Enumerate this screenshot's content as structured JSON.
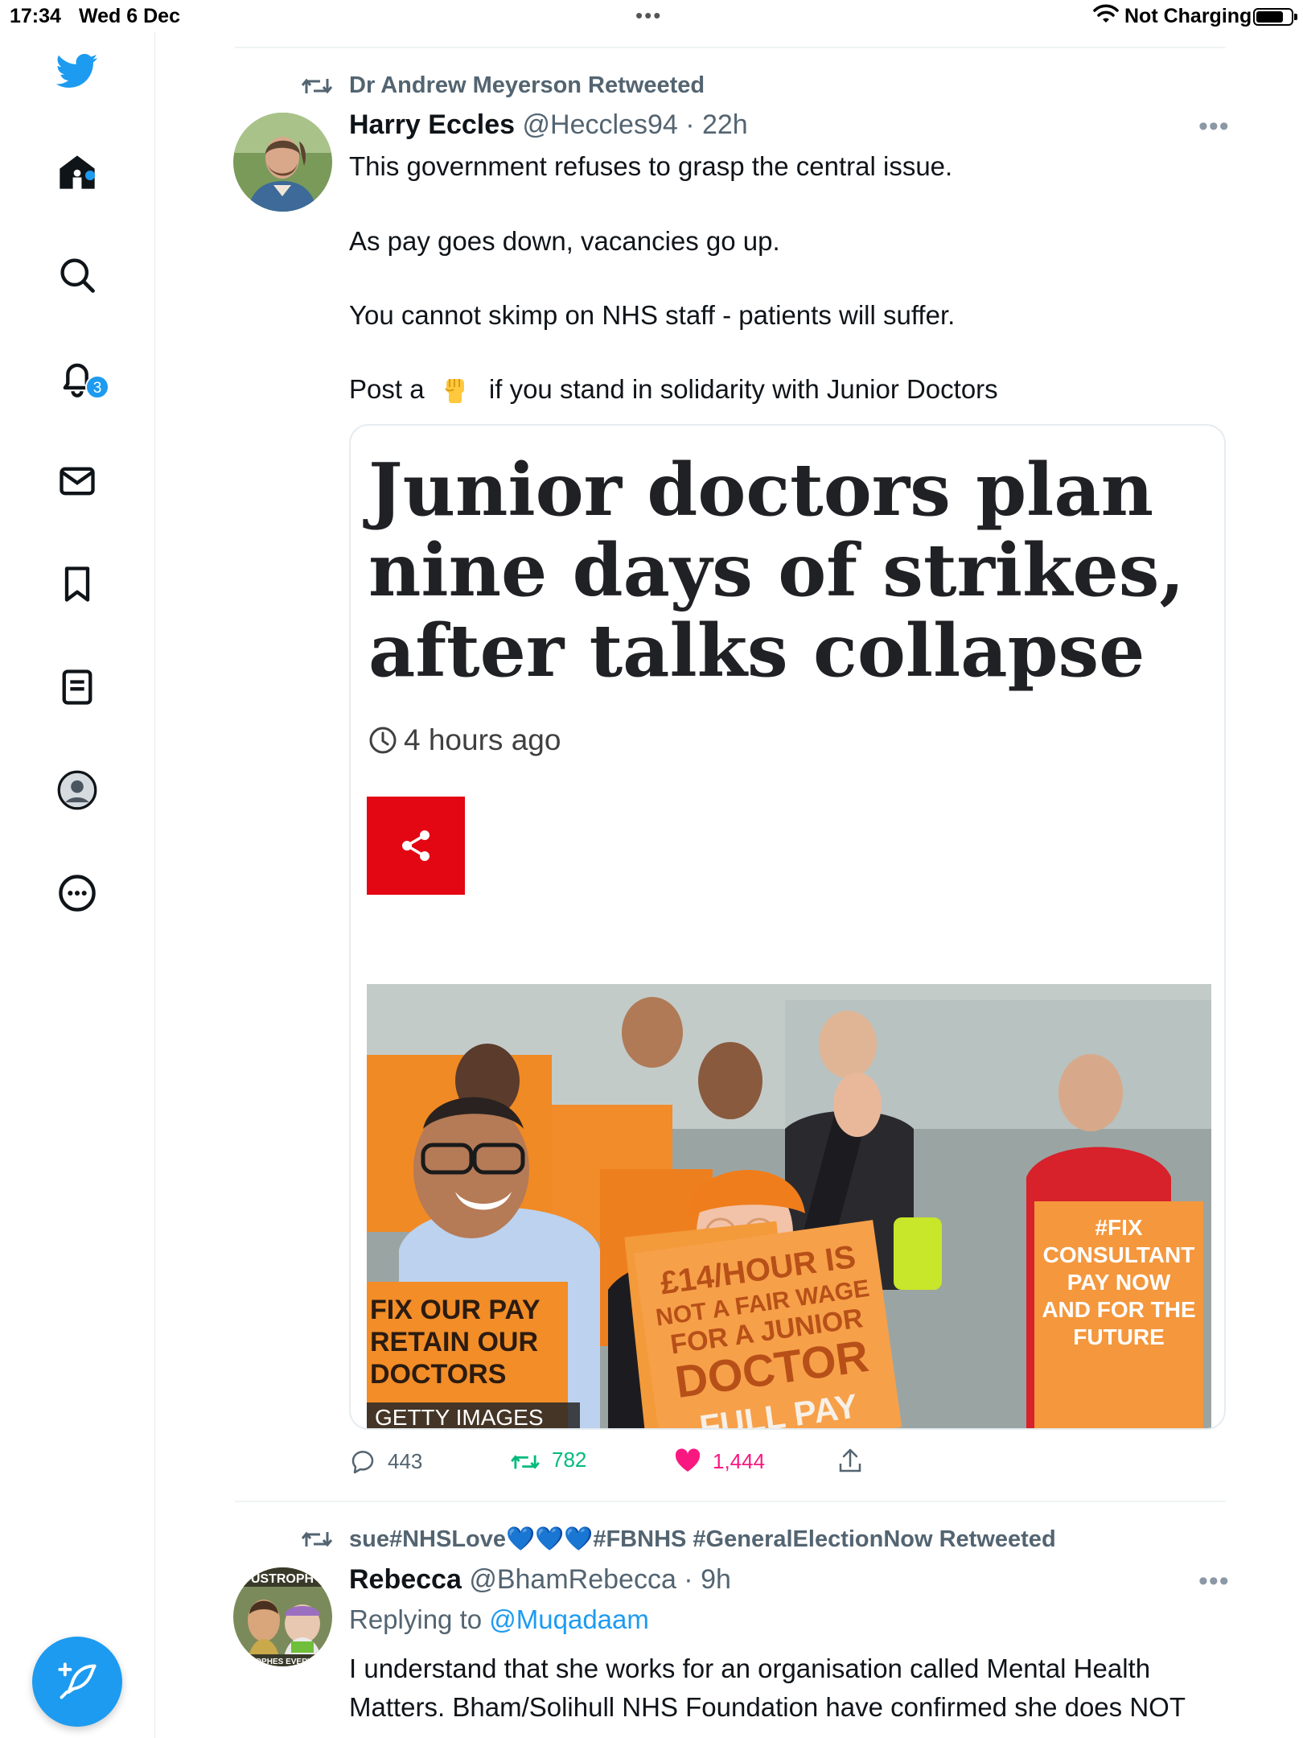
{
  "status_bar": {
    "time": "17:34",
    "date": "Wed 6 Dec",
    "dots": "•••",
    "battery_text": "Not Charging"
  },
  "sidebar": {
    "items": [
      {
        "icon": "twitter-bird-icon"
      },
      {
        "icon": "home-icon"
      },
      {
        "icon": "search-icon"
      },
      {
        "icon": "notifications-icon",
        "badge": "3"
      },
      {
        "icon": "messages-icon"
      },
      {
        "icon": "bookmarks-icon"
      },
      {
        "icon": "lists-icon"
      },
      {
        "icon": "profile-icon"
      },
      {
        "icon": "more-icon"
      }
    ],
    "compose_icon": "compose-tweet-icon"
  },
  "tweets": [
    {
      "retweeted_by": "Dr Andrew Meyerson Retweeted",
      "name": "Harry Eccles",
      "handle": "@Heccles94",
      "age": "22h",
      "lines": [
        "This government refuses to grasp the central issue.",
        "As pay goes down, vacancies go up.",
        "You cannot skimp on NHS staff - patients will suffer.",
        "Post a",
        "if you stand in solidarity with  Junior Doctors"
      ],
      "card": {
        "headline": [
          "Junior doctors plan",
          "nine days of strikes,",
          "after talks collapse"
        ],
        "time_ago": "4 hours ago",
        "photo_credit": "GETTY IMAGES",
        "signs": [
          "£14/HOUR IS",
          "NOT A FAIR WAGE",
          "FOR A JUNIOR",
          "DOCTOR",
          "FULL PAY",
          "#FIX",
          "CONSULTANT",
          "PAY NOW",
          "AND FOR THE",
          "FUTURE",
          "FIX OUR PAY",
          "RETAIN OUR",
          "DOCTORS"
        ]
      },
      "actions": {
        "replies": "443",
        "retweets": "782",
        "likes": "1,444"
      }
    },
    {
      "retweeted_by": "sue#NHSLove💙💙💙#FBNHS #GeneralElectionNow Retweeted",
      "name": "Rebecca",
      "handle": "@BhamRebecca",
      "age": "9h",
      "replying_prefix": "Replying to",
      "replying_handle": "@Muqadaam",
      "avatar_text_top": "USTROPH",
      "avatar_text_bottom": "TROPHES EVERYW",
      "lines": [
        "I understand that she works for an organisation called Mental Health",
        "Matters. Bham/Solihull NHS Foundation have confirmed she does NOT"
      ]
    }
  ],
  "colors": {
    "accent": "#1d9bf0",
    "retweet": "#00ba7c",
    "like": "#f91880",
    "muted": "#536471",
    "share_red": "#e30613"
  }
}
